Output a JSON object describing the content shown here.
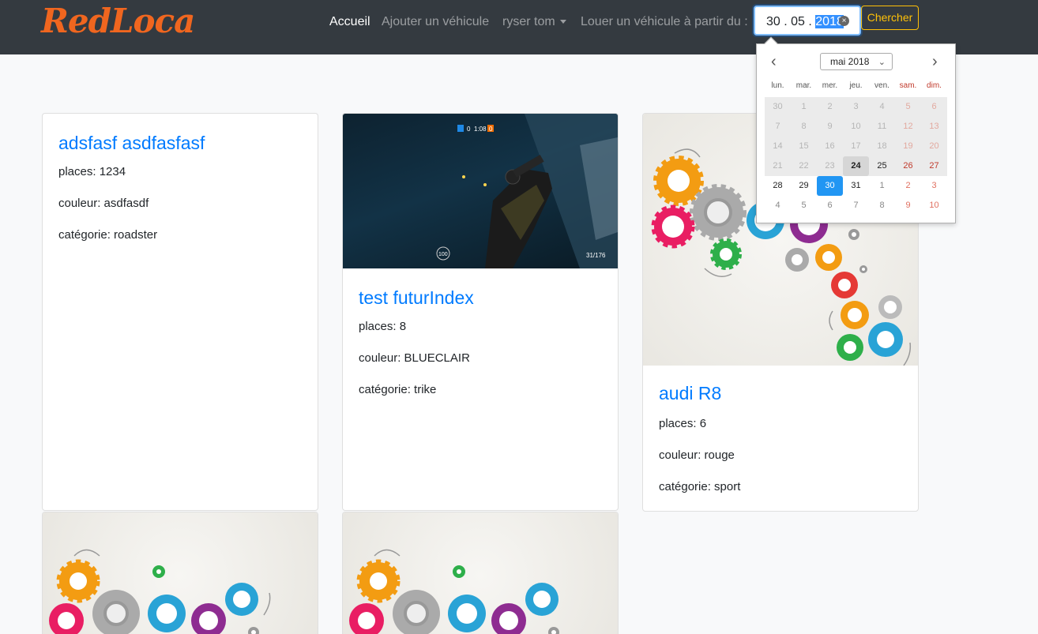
{
  "navbar": {
    "brand": "RedLoca",
    "items": [
      {
        "label": "Accueil",
        "active": true
      },
      {
        "label": "Ajouter un véhicule",
        "active": false
      },
      {
        "label": "ryser tom",
        "active": false,
        "dropdown": true
      },
      {
        "label": "Louer un véhicule à partir du :",
        "active": false
      }
    ],
    "date_input": {
      "day_month": "30 . 05 . ",
      "year": "2018"
    },
    "search_label": "Chercher"
  },
  "calendar": {
    "month_label": "mai 2018",
    "weekdays": [
      "lun.",
      "mar.",
      "mer.",
      "jeu.",
      "ven.",
      "sam.",
      "dim."
    ],
    "weeks": [
      [
        "30",
        "1",
        "2",
        "3",
        "4",
        "5",
        "6"
      ],
      [
        "7",
        "8",
        "9",
        "10",
        "11",
        "12",
        "13"
      ],
      [
        "14",
        "15",
        "16",
        "17",
        "18",
        "19",
        "20"
      ],
      [
        "21",
        "22",
        "23",
        "24",
        "25",
        "26",
        "27"
      ],
      [
        "28",
        "29",
        "30",
        "31",
        "1",
        "2",
        "3"
      ],
      [
        "4",
        "5",
        "6",
        "7",
        "8",
        "9",
        "10"
      ]
    ],
    "today": "24",
    "selected": "30"
  },
  "cards": [
    {
      "title": "adsfasf asdfasfasf",
      "places": "places: 1234",
      "couleur": "couleur: asdfasdf",
      "categorie": "catégorie: roadster",
      "image": "none"
    },
    {
      "title": "test futurIndex",
      "places": "places: 8",
      "couleur": "couleur: BLUECLAIR",
      "categorie": "catégorie: trike",
      "image": "game-screenshot"
    },
    {
      "title": "audi R8",
      "places": "places: 6",
      "couleur": "couleur: rouge",
      "categorie": "catégorie: sport",
      "image": "colorful-gears"
    },
    {
      "image": "colorful-gears"
    },
    {
      "image": "colorful-gears"
    }
  ],
  "game_hud": {
    "timer": "1:08",
    "score_left": "0",
    "score_right": "0",
    "health": "100",
    "ammo": "31/176"
  },
  "colors": {
    "navbar_bg": "#343a40",
    "brand": "#f0661f",
    "link": "#007bff",
    "search_btn": "#ffc107",
    "selected_day": "#2196f3"
  }
}
